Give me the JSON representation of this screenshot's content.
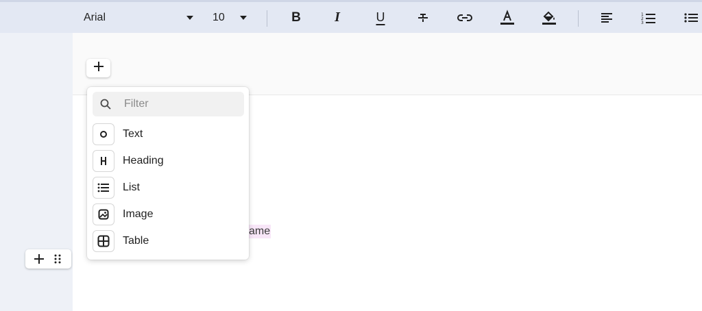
{
  "toolbar": {
    "font_family": "Arial",
    "font_size": "10",
    "buttons": [
      {
        "name": "bold",
        "glyph": "B"
      },
      {
        "name": "italic",
        "glyph": "I"
      },
      {
        "name": "underline",
        "glyph": "U"
      },
      {
        "name": "strikethrough",
        "glyph": "S"
      }
    ]
  },
  "editor": {
    "visible_text": "ame"
  },
  "menu": {
    "filter_placeholder": "Filter",
    "items": [
      {
        "label": "Text",
        "icon": "text-circle-icon"
      },
      {
        "label": "Heading",
        "icon": "heading-h-icon"
      },
      {
        "label": "List",
        "icon": "list-icon"
      },
      {
        "label": "Image",
        "icon": "image-icon"
      },
      {
        "label": "Table",
        "icon": "table-icon"
      }
    ]
  },
  "colors": {
    "toolbar_bg": "#e3e8f3",
    "gutter_bg": "#eef1f7",
    "highlight_bg": "#f8e6f8"
  }
}
